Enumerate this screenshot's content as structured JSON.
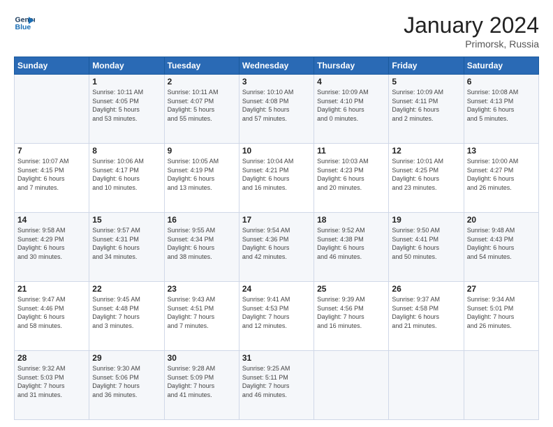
{
  "header": {
    "logo_line1": "General",
    "logo_line2": "Blue",
    "main_title": "January 2024",
    "subtitle": "Primorsk, Russia"
  },
  "weekdays": [
    "Sunday",
    "Monday",
    "Tuesday",
    "Wednesday",
    "Thursday",
    "Friday",
    "Saturday"
  ],
  "weeks": [
    [
      {
        "day": "",
        "info": ""
      },
      {
        "day": "1",
        "info": "Sunrise: 10:11 AM\nSunset: 4:05 PM\nDaylight: 5 hours\nand 53 minutes."
      },
      {
        "day": "2",
        "info": "Sunrise: 10:11 AM\nSunset: 4:07 PM\nDaylight: 5 hours\nand 55 minutes."
      },
      {
        "day": "3",
        "info": "Sunrise: 10:10 AM\nSunset: 4:08 PM\nDaylight: 5 hours\nand 57 minutes."
      },
      {
        "day": "4",
        "info": "Sunrise: 10:09 AM\nSunset: 4:10 PM\nDaylight: 6 hours\nand 0 minutes."
      },
      {
        "day": "5",
        "info": "Sunrise: 10:09 AM\nSunset: 4:11 PM\nDaylight: 6 hours\nand 2 minutes."
      },
      {
        "day": "6",
        "info": "Sunrise: 10:08 AM\nSunset: 4:13 PM\nDaylight: 6 hours\nand 5 minutes."
      }
    ],
    [
      {
        "day": "7",
        "info": "Sunrise: 10:07 AM\nSunset: 4:15 PM\nDaylight: 6 hours\nand 7 minutes."
      },
      {
        "day": "8",
        "info": "Sunrise: 10:06 AM\nSunset: 4:17 PM\nDaylight: 6 hours\nand 10 minutes."
      },
      {
        "day": "9",
        "info": "Sunrise: 10:05 AM\nSunset: 4:19 PM\nDaylight: 6 hours\nand 13 minutes."
      },
      {
        "day": "10",
        "info": "Sunrise: 10:04 AM\nSunset: 4:21 PM\nDaylight: 6 hours\nand 16 minutes."
      },
      {
        "day": "11",
        "info": "Sunrise: 10:03 AM\nSunset: 4:23 PM\nDaylight: 6 hours\nand 20 minutes."
      },
      {
        "day": "12",
        "info": "Sunrise: 10:01 AM\nSunset: 4:25 PM\nDaylight: 6 hours\nand 23 minutes."
      },
      {
        "day": "13",
        "info": "Sunrise: 10:00 AM\nSunset: 4:27 PM\nDaylight: 6 hours\nand 26 minutes."
      }
    ],
    [
      {
        "day": "14",
        "info": "Sunrise: 9:58 AM\nSunset: 4:29 PM\nDaylight: 6 hours\nand 30 minutes."
      },
      {
        "day": "15",
        "info": "Sunrise: 9:57 AM\nSunset: 4:31 PM\nDaylight: 6 hours\nand 34 minutes."
      },
      {
        "day": "16",
        "info": "Sunrise: 9:55 AM\nSunset: 4:34 PM\nDaylight: 6 hours\nand 38 minutes."
      },
      {
        "day": "17",
        "info": "Sunrise: 9:54 AM\nSunset: 4:36 PM\nDaylight: 6 hours\nand 42 minutes."
      },
      {
        "day": "18",
        "info": "Sunrise: 9:52 AM\nSunset: 4:38 PM\nDaylight: 6 hours\nand 46 minutes."
      },
      {
        "day": "19",
        "info": "Sunrise: 9:50 AM\nSunset: 4:41 PM\nDaylight: 6 hours\nand 50 minutes."
      },
      {
        "day": "20",
        "info": "Sunrise: 9:48 AM\nSunset: 4:43 PM\nDaylight: 6 hours\nand 54 minutes."
      }
    ],
    [
      {
        "day": "21",
        "info": "Sunrise: 9:47 AM\nSunset: 4:46 PM\nDaylight: 6 hours\nand 58 minutes."
      },
      {
        "day": "22",
        "info": "Sunrise: 9:45 AM\nSunset: 4:48 PM\nDaylight: 7 hours\nand 3 minutes."
      },
      {
        "day": "23",
        "info": "Sunrise: 9:43 AM\nSunset: 4:51 PM\nDaylight: 7 hours\nand 7 minutes."
      },
      {
        "day": "24",
        "info": "Sunrise: 9:41 AM\nSunset: 4:53 PM\nDaylight: 7 hours\nand 12 minutes."
      },
      {
        "day": "25",
        "info": "Sunrise: 9:39 AM\nSunset: 4:56 PM\nDaylight: 7 hours\nand 16 minutes."
      },
      {
        "day": "26",
        "info": "Sunrise: 9:37 AM\nSunset: 4:58 PM\nDaylight: 6 hours\nand 21 minutes."
      },
      {
        "day": "27",
        "info": "Sunrise: 9:34 AM\nSunset: 5:01 PM\nDaylight: 7 hours\nand 26 minutes."
      }
    ],
    [
      {
        "day": "28",
        "info": "Sunrise: 9:32 AM\nSunset: 5:03 PM\nDaylight: 7 hours\nand 31 minutes."
      },
      {
        "day": "29",
        "info": "Sunrise: 9:30 AM\nSunset: 5:06 PM\nDaylight: 7 hours\nand 36 minutes."
      },
      {
        "day": "30",
        "info": "Sunrise: 9:28 AM\nSunset: 5:09 PM\nDaylight: 7 hours\nand 41 minutes."
      },
      {
        "day": "31",
        "info": "Sunrise: 9:25 AM\nSunset: 5:11 PM\nDaylight: 7 hours\nand 46 minutes."
      },
      {
        "day": "",
        "info": ""
      },
      {
        "day": "",
        "info": ""
      },
      {
        "day": "",
        "info": ""
      }
    ]
  ]
}
